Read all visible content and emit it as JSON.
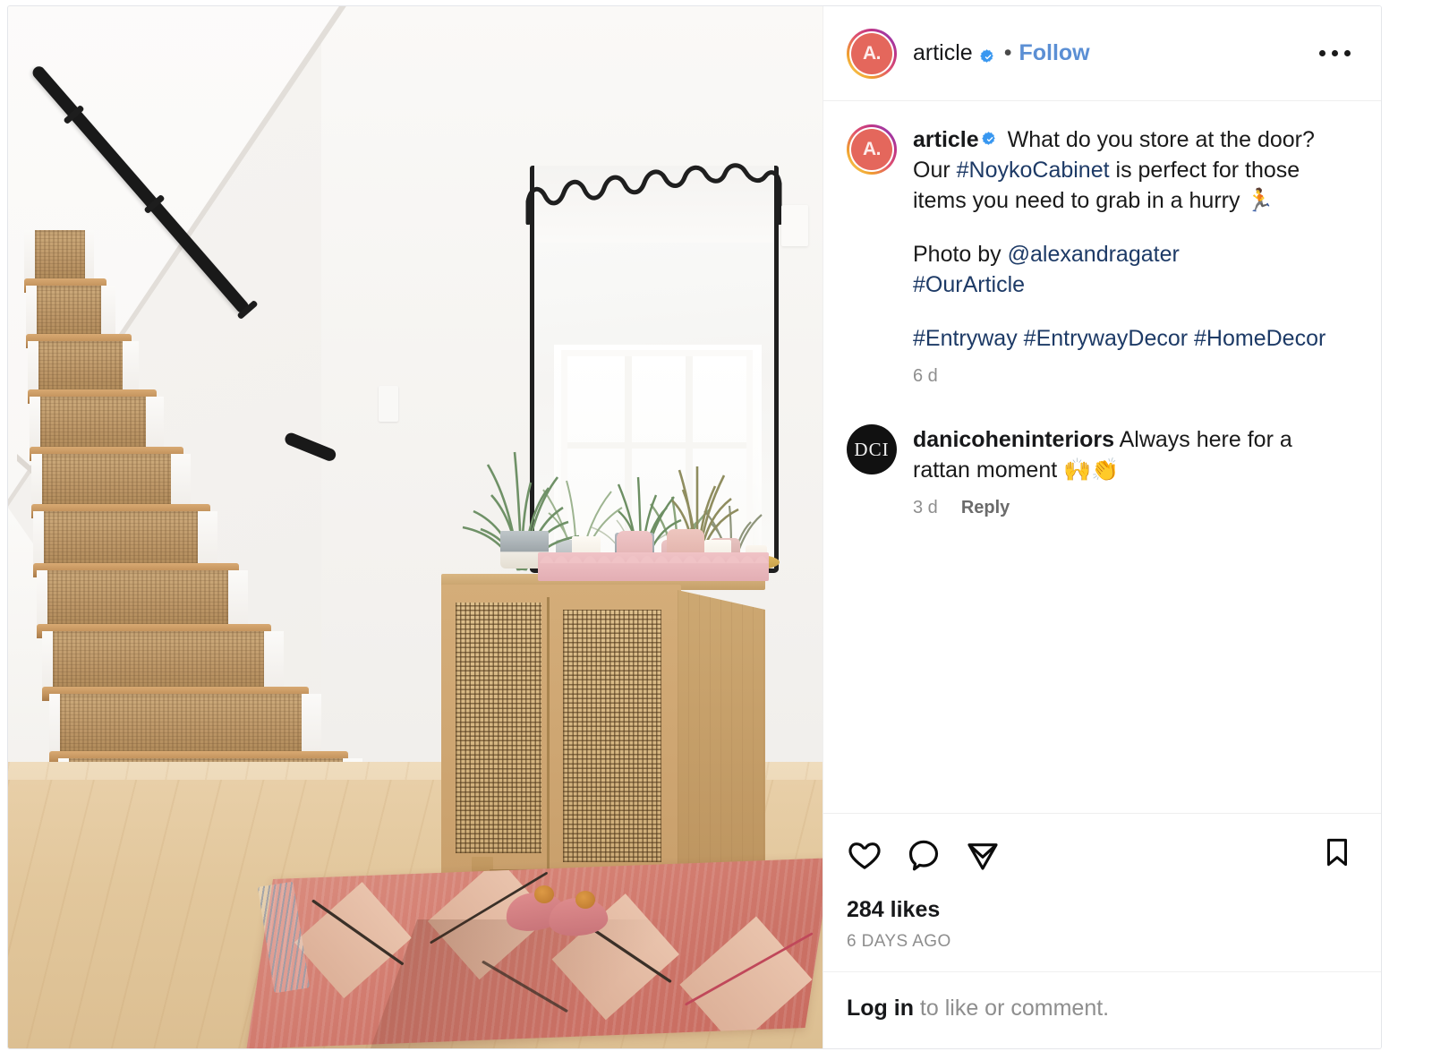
{
  "post": {
    "header": {
      "avatar_initials": "A.",
      "username": "article",
      "verified_badge": "verified-badge",
      "separator": "•",
      "follow_label": "Follow",
      "more_menu": "more-options"
    },
    "caption": {
      "author": "article",
      "text_part1": " What do you store at the door? Our ",
      "hashtag_noyko": "#NoykoCabinet",
      "text_part2": " is perfect for those items you need to grab in a hurry 🏃",
      "photo_credit_prefix": "Photo by ",
      "photo_credit_mention": "@alexandragater",
      "hashtag_ourarticle": "#OurArticle",
      "hashtag_entryway": "#Entryway",
      "hashtag_entrywaydecor": "#EntrywayDecor",
      "hashtag_homedecor": "#HomeDecor",
      "timestamp": "6 d"
    },
    "comment": {
      "avatar_initials": "DCI",
      "username": "danicoheninteriors",
      "text": " Always here for a rattan moment 🙌👏",
      "timestamp": "3 d",
      "reply_label": "Reply"
    },
    "actions": {
      "like_icon": "heart-icon",
      "comment_icon": "comment-bubble-icon",
      "share_icon": "share-paper-plane-icon",
      "bookmark_icon": "bookmark-icon",
      "likes_count": "284 likes",
      "posted_ago": "6 DAYS AGO"
    },
    "footer": {
      "login_link": "Log in",
      "login_rest": " to like or comment."
    },
    "colors": {
      "link_blue": "#5b8fd4",
      "hashtag_navy": "#1d3a66",
      "verified_blue": "#3897f0",
      "text_primary": "#17181a",
      "text_muted": "#8e8e8e",
      "avatar_bg": "#e4675c"
    }
  },
  "photo": {
    "alt": "Entryway with staircase, cane cabinet, wavy mirror and pink rug",
    "elements": [
      "staircase-with-jute-runner",
      "black-handrail",
      "wavy-top-black-mirror",
      "cane-front-cabinet",
      "potted-plants",
      "pink-scalloped-tray",
      "candles",
      "pink-slippers",
      "terracotta-moroccan-rug",
      "light-oak-floor"
    ]
  }
}
